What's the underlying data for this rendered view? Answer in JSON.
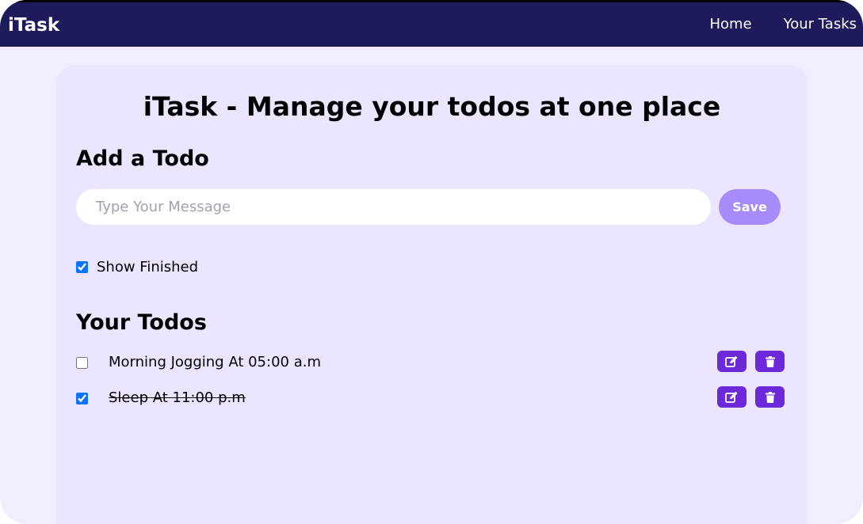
{
  "navbar": {
    "brand": "iTask",
    "links": [
      "Home",
      "Your Tasks"
    ]
  },
  "main": {
    "title": "iTask - Manage your todos at one place",
    "add_section_title": "Add a Todo",
    "input": {
      "placeholder": "Type Your Message",
      "value": ""
    },
    "save_label": "Save",
    "show_finished": {
      "label": "Show Finished",
      "checked": true
    },
    "todos_title": "Your Todos",
    "todos": [
      {
        "text": "Morning Jogging At 05:00 a.m",
        "done": false
      },
      {
        "text": "Sleep At 11:00 p.m",
        "done": true
      }
    ]
  },
  "colors": {
    "navbar_bg": "#1e1b5c",
    "page_bg": "#f1edff",
    "card_bg": "#ebe5ff",
    "save_button": "#a78bfa",
    "action_button": "#6d28d9",
    "checkbox_accent": "#0a74ff"
  },
  "icons": [
    "edit-icon",
    "trash-icon"
  ]
}
